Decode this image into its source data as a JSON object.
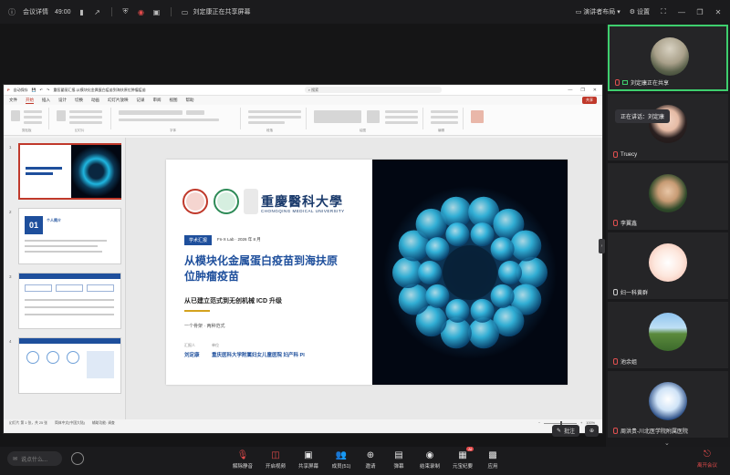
{
  "topbar": {
    "meeting_details": "会议详情",
    "duration": "49:00",
    "sharing_status": "刘定康正在共享屏幕",
    "speaker_layout": "演讲者布局",
    "settings": "设置"
  },
  "ppt": {
    "autosave": "自动保存",
    "file_title": "重医翟丽汇报-从模块化金属蛋白疫苗到海扶原位肿瘤疫苗",
    "search_placeholder": "搜索",
    "menu": [
      "文件",
      "开始",
      "插入",
      "设计",
      "切换",
      "动画",
      "幻灯片放映",
      "记录",
      "审阅",
      "视图",
      "帮助"
    ],
    "share_label": "共享",
    "ribbon_groups": [
      "剪贴板",
      "幻灯片",
      "字体",
      "段落",
      "绘图",
      "编辑"
    ],
    "thumb_numbers": [
      "1",
      "2",
      "3",
      "4"
    ],
    "thumb2_number": "01",
    "thumb2_title": "个人简介",
    "status_left": "幻灯片 第 1 张，共 25 张",
    "status_lang": "简体中文(中国大陆)",
    "status_a11y": "辅助功能: 调查",
    "zoom": "100%"
  },
  "slide": {
    "univ_name": "重慶醫科大學",
    "univ_en": "CHONGQING MEDICAL UNIVERSITY",
    "tag": "学术汇报",
    "lab_tag": "Fn-X Lab · 2026 年 8 月",
    "title_line1": "从模块化金属蛋白疫苗到海扶原",
    "title_line2": "位肿瘤疫苗",
    "subtitle": "从已建立范式到无创机械 ICD 升级",
    "tagline": "一个骨架 · 两种范式",
    "reporter_label": "汇报人",
    "unit_label": "单位",
    "reporter": "刘定康",
    "unit": "重庆医科大学附属妇女儿童医院 妇产科 PI"
  },
  "share_tools": {
    "annotate": "批注"
  },
  "participants": [
    {
      "name": "刘定康正在共享",
      "featured": true,
      "avatar": "road"
    },
    {
      "name": "Truecy",
      "featured": false,
      "avatar": "girl"
    },
    {
      "name": "李翼鑫",
      "featured": false,
      "avatar": "boy"
    },
    {
      "name": "妇一科黄群",
      "featured": false,
      "avatar": "cartoon"
    },
    {
      "name": "池余姐",
      "featured": false,
      "avatar": "lake"
    },
    {
      "name": "周洪贵-川北医学院附属医院",
      "featured": false,
      "avatar": "glasses"
    }
  ],
  "tooltip": "正在讲话：刘定康",
  "controls": {
    "chat_placeholder": "说点什么...",
    "buttons": [
      {
        "label": "解除静音",
        "icon": "mic-off"
      },
      {
        "label": "开启视频",
        "icon": "video-off"
      },
      {
        "label": "共享屏幕",
        "icon": "share"
      },
      {
        "label": "成员(51)",
        "icon": "members"
      },
      {
        "label": "邀请",
        "icon": "invite"
      },
      {
        "label": "弹幕",
        "icon": "danmaku"
      },
      {
        "label": "结束录制",
        "icon": "record"
      },
      {
        "label": "元宝纪要",
        "icon": "ai-notes",
        "badge": "AI"
      },
      {
        "label": "应用",
        "icon": "apps"
      }
    ],
    "leave": "离开会议"
  },
  "colors": {
    "accent_blue": "#1e4f9c",
    "speaking_green": "#3ecf6e",
    "danger_red": "#e34b4b"
  }
}
